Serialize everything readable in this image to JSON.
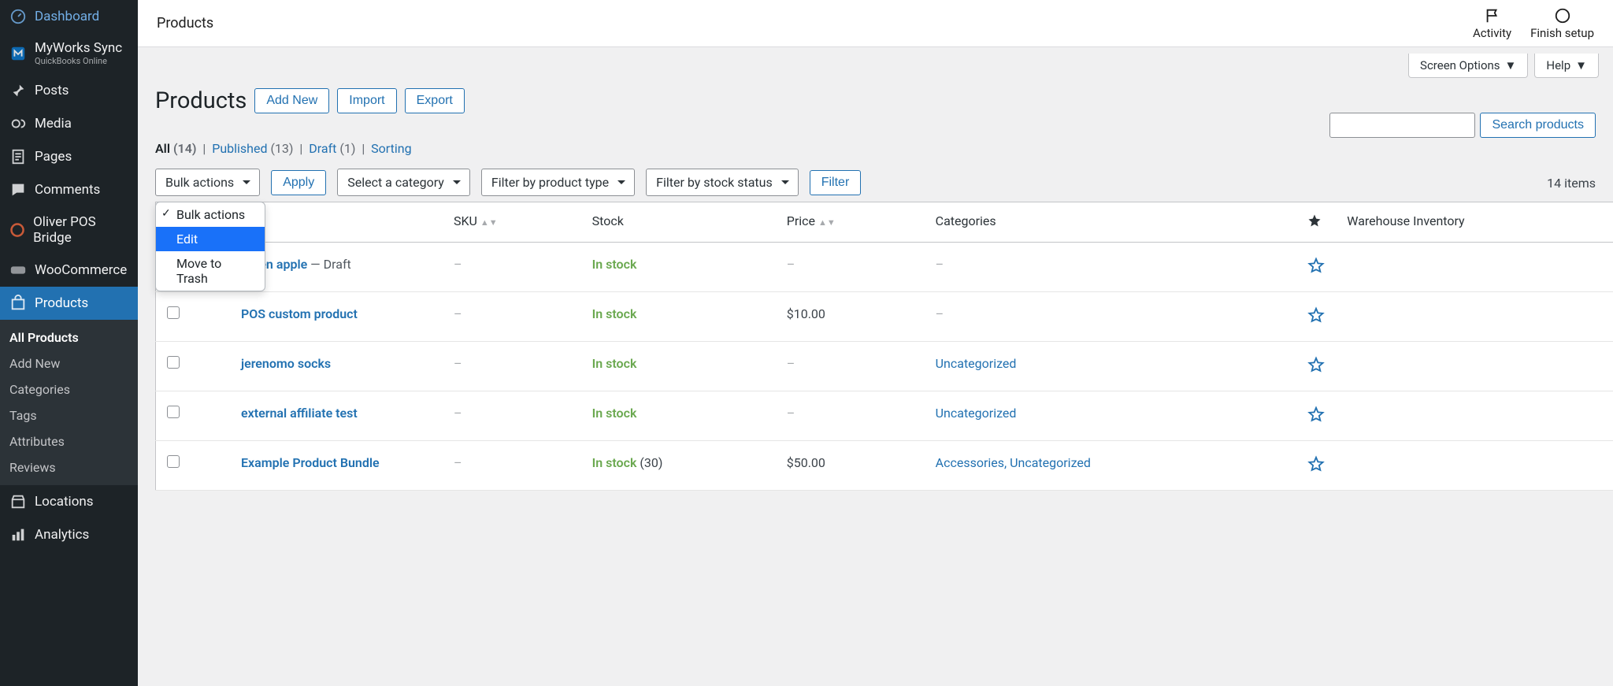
{
  "sidebar": {
    "items": [
      {
        "label": "Dashboard"
      },
      {
        "label": "MyWorks Sync",
        "sub": "QuickBooks Online"
      },
      {
        "label": "Posts"
      },
      {
        "label": "Media"
      },
      {
        "label": "Pages"
      },
      {
        "label": "Comments"
      },
      {
        "label": "Oliver POS Bridge"
      },
      {
        "label": "WooCommerce"
      },
      {
        "label": "Products"
      },
      {
        "label": "Locations"
      },
      {
        "label": "Analytics"
      }
    ],
    "submenu": [
      {
        "label": "All Products",
        "active": true
      },
      {
        "label": "Add New"
      },
      {
        "label": "Categories"
      },
      {
        "label": "Tags"
      },
      {
        "label": "Attributes"
      },
      {
        "label": "Reviews"
      }
    ]
  },
  "woo_header": {
    "breadcrumb": "Products",
    "activity": "Activity",
    "finish": "Finish setup"
  },
  "screen_tabs": {
    "screen_options": "Screen Options",
    "help": "Help"
  },
  "page": {
    "title": "Products",
    "add_new": "Add New",
    "import": "Import",
    "export": "Export"
  },
  "status_links": {
    "all": "All",
    "all_count": "(14)",
    "published": "Published",
    "published_count": "(13)",
    "draft": "Draft",
    "draft_count": "(1)",
    "sorting": "Sorting"
  },
  "search": {
    "button": "Search products"
  },
  "filters": {
    "bulk_label": "Bulk actions",
    "apply": "Apply",
    "category": "Select a category",
    "product_type": "Filter by product type",
    "stock_status": "Filter by stock status",
    "filter": "Filter",
    "count": "14 items",
    "bulk_options": [
      "Bulk actions",
      "Edit",
      "Move to Trash"
    ]
  },
  "columns": {
    "sku": "SKU",
    "stock": "Stock",
    "price": "Price",
    "categories": "Categories",
    "warehouse": "Warehouse Inventory"
  },
  "products": [
    {
      "name": "green apple",
      "status": " — Draft",
      "sku": "–",
      "stock": "In stock",
      "stock_qty": "",
      "price": "–",
      "categories": "–"
    },
    {
      "name": "POS custom product",
      "status": "",
      "sku": "–",
      "stock": "In stock",
      "stock_qty": "",
      "price": "$10.00",
      "categories": "–"
    },
    {
      "name": "jerenomo socks",
      "status": "",
      "sku": "–",
      "stock": "In stock",
      "stock_qty": "",
      "price": "–",
      "categories": "Uncategorized"
    },
    {
      "name": "external affiliate test",
      "status": "",
      "sku": "–",
      "stock": "In stock",
      "stock_qty": "",
      "price": "–",
      "categories": "Uncategorized"
    },
    {
      "name": "Example Product Bundle",
      "status": "",
      "sku": "–",
      "stock": "In stock",
      "stock_qty": " (30)",
      "price": "$50.00",
      "categories": "Accessories, Uncategorized"
    }
  ]
}
